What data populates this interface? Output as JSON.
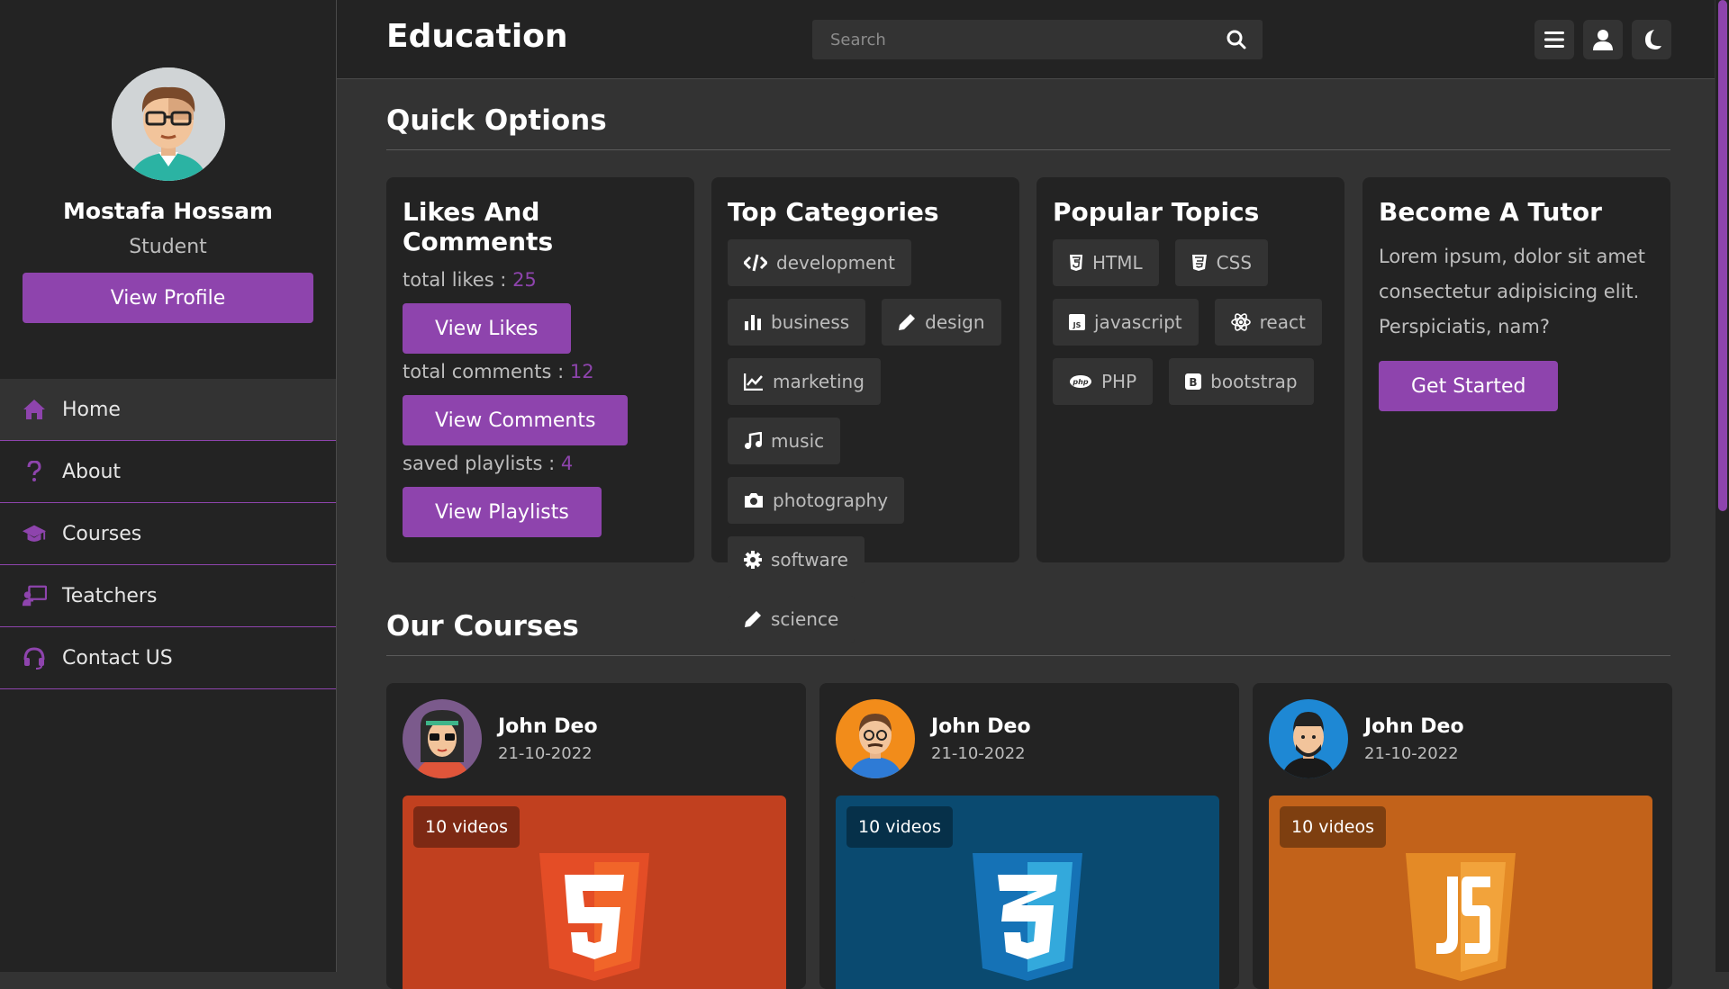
{
  "app": {
    "title": "Education"
  },
  "search": {
    "placeholder": "Search"
  },
  "profile": {
    "name": "Mostafa Hossam",
    "role": "Student",
    "button": "View Profile"
  },
  "nav": [
    {
      "label": "Home",
      "icon": "home-icon"
    },
    {
      "label": "About",
      "icon": "question-icon"
    },
    {
      "label": "Courses",
      "icon": "graduation-cap-icon"
    },
    {
      "label": "Teatchers",
      "icon": "chalkboard-teacher-icon"
    },
    {
      "label": "Contact US",
      "icon": "headset-icon"
    }
  ],
  "quick_options": {
    "title": "Quick Options",
    "likes": {
      "title": "Likes And Comments",
      "total_likes_label": "total likes : ",
      "total_likes": "25",
      "view_likes": "View Likes",
      "total_comments_label": "total comments : ",
      "total_comments": "12",
      "view_comments": "View Comments",
      "saved_playlists_label": "saved playlists : ",
      "saved_playlists": "4",
      "view_playlists": "View Playlists"
    },
    "categories": {
      "title": "Top Categories",
      "items": [
        "development",
        "business",
        "design",
        "marketing",
        "music",
        "photography",
        "software",
        "science"
      ]
    },
    "topics": {
      "title": "Popular Topics",
      "items": [
        "HTML",
        "CSS",
        "javascript",
        "react",
        "PHP",
        "bootstrap"
      ]
    },
    "tutor": {
      "title": "Become A Tutor",
      "text": "Lorem ipsum, dolor sit amet consectetur adipisicing elit. Perspiciatis, nam?",
      "button": "Get Started"
    }
  },
  "courses": {
    "title": "Our Courses",
    "items": [
      {
        "tutor": "John Deo",
        "date": "21-10-2022",
        "videos": "10 videos",
        "color": "#c1401f"
      },
      {
        "tutor": "John Deo",
        "date": "21-10-2022",
        "videos": "10 videos",
        "color": "#0a4a70"
      },
      {
        "tutor": "John Deo",
        "date": "21-10-2022",
        "videos": "10 videos",
        "color": "#c2621a"
      }
    ]
  },
  "colors": {
    "accent": "#8e44ad",
    "bg": "#333333",
    "panel": "#232323"
  }
}
